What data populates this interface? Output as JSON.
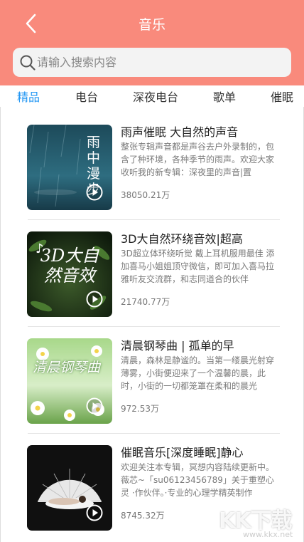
{
  "header": {
    "title": "音乐",
    "back_icon": "chevron-left-icon",
    "bg_color": "#f98a7c"
  },
  "search": {
    "placeholder": "请输入搜索内容",
    "value": "",
    "icon": "search-icon"
  },
  "tabs": [
    {
      "label": "精品",
      "active": true
    },
    {
      "label": "电台",
      "active": false
    },
    {
      "label": "深夜电台",
      "active": false
    },
    {
      "label": "歌单",
      "active": false
    },
    {
      "label": "催眠",
      "active": false
    }
  ],
  "albums": [
    {
      "title": "雨声催眠 大自然的声音",
      "desc": "整张专辑声音都是声谷去户外录制的，包含了种环境，各种季节的雨声。欢迎大家收听我的新专辑：深夜里的声音|置",
      "plays": "38050.21万",
      "cover_text": "雨中漫步"
    },
    {
      "title": "3D大自然环绕音效|超高",
      "desc": "3D超立体环绕听觉 戴上耳机服用最佳 添加喜马小姐姐顶守微信，即可加入喜马拉雅听友交流群，和志同道合的伙伴",
      "plays": "21740.77万",
      "cover_text": "3D大自然音效"
    },
    {
      "title": "清晨钢琴曲 | 孤单的早",
      "desc": "清晨，森林是静谧的。当第一缕晨光射穿薄雾，小街便迎来了一个温馨的晨，此时，小街的一切都笼罩在柔和的晨光",
      "plays": "972.53万",
      "cover_text": "清晨钢琴曲"
    },
    {
      "title": "催眠音乐[深度睡眠]静心",
      "desc": "欢迎关注本专辑，冥想内容陆续更新中。薇芯~「su06123456789」关于重塑心灵 ·作伙伴。·专业的心理学精英制作",
      "plays": "8745.32万",
      "cover_text": ""
    }
  ],
  "watermark": {
    "logo": "KK下载",
    "url": "www.kkx.net"
  },
  "colors": {
    "accent": "#2196f3",
    "header": "#f98a7c"
  }
}
